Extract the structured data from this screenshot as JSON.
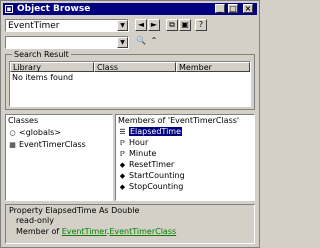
{
  "window": {
    "title": "Object Browse",
    "controls": [
      "_",
      "□",
      "×"
    ]
  },
  "toolbar": {
    "library_value": "EventTimer",
    "search_value": "",
    "back_label": "◄",
    "forward_label": "►",
    "copy_label": "⧉",
    "definition_label": "▣",
    "help_label": "?",
    "search_button_label": "🔍",
    "toggle_label": "⌃"
  },
  "search_results": {
    "label": "Search Result",
    "columns": [
      "Library",
      "Class",
      "Member"
    ],
    "empty_text": "No items found"
  },
  "classes": {
    "label": "Classes",
    "items": [
      {
        "name": "<globals>",
        "icon": "○"
      },
      {
        "name": "EventTimerClass",
        "icon": "▦"
      }
    ]
  },
  "members": {
    "label": "Members of 'EventTimerClass'",
    "items": [
      {
        "name": "ElapsedTime",
        "icon": "☰",
        "selected": true
      },
      {
        "name": "Hour",
        "icon": "ℙ",
        "selected": false
      },
      {
        "name": "Minute",
        "icon": "ℙ",
        "selected": false
      },
      {
        "name": "ResetTimer",
        "icon": "◆",
        "selected": false
      },
      {
        "name": "StartCounting",
        "icon": "◆",
        "selected": false
      },
      {
        "name": "StopCounting",
        "icon": "◆",
        "selected": false
      }
    ]
  },
  "details": {
    "line1": "Property ElapsedTime As Double",
    "line2": "read-only",
    "line3_prefix": "Member of",
    "line3_link1": "EventTimer",
    "line3_dot": ".",
    "line3_link2": "EventTimerClass"
  }
}
